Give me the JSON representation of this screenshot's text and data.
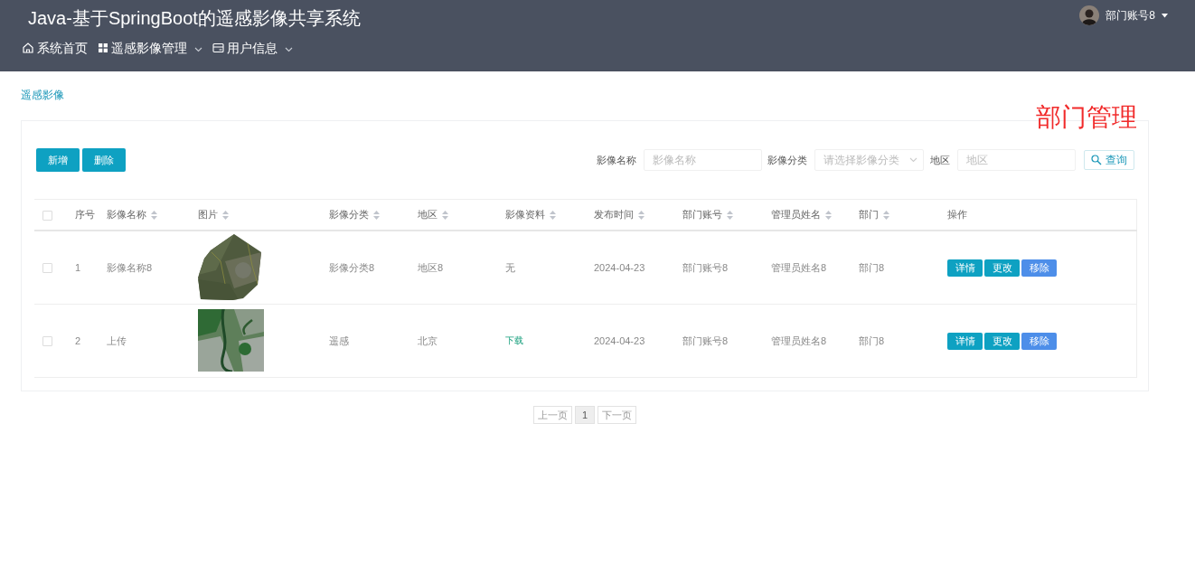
{
  "header": {
    "title": "Java-基于SpringBoot的遥感影像共享系统",
    "nav": [
      {
        "label": "系统首页",
        "dropdown": false
      },
      {
        "label": "遥感影像管理",
        "dropdown": true
      },
      {
        "label": "用户信息",
        "dropdown": true
      }
    ],
    "user": {
      "name": "部门账号8"
    }
  },
  "breadcrumb": "遥感影像",
  "overlay_caption": "部门管理",
  "toolbar": {
    "buttons": [
      "新增",
      "删除"
    ],
    "filters": [
      {
        "label": "影像名称",
        "kind": "input",
        "placeholder": "影像名称"
      },
      {
        "label": "影像分类",
        "kind": "select",
        "placeholder": "请选择影像分类"
      },
      {
        "label": "地区",
        "kind": "input",
        "placeholder": "地区"
      }
    ],
    "search_button": "查询"
  },
  "table": {
    "select_all_checked": false,
    "columns": [
      {
        "label": "序号",
        "sortable": false
      },
      {
        "label": "影像名称",
        "sortable": true
      },
      {
        "label": "图片",
        "sortable": true
      },
      {
        "label": "影像分类",
        "sortable": true
      },
      {
        "label": "地区",
        "sortable": true
      },
      {
        "label": "影像资料",
        "sortable": true
      },
      {
        "label": "发布时间",
        "sortable": true
      },
      {
        "label": "部门账号",
        "sortable": true
      },
      {
        "label": "管理员姓名",
        "sortable": true
      },
      {
        "label": "部门",
        "sortable": true
      },
      {
        "label": "操作",
        "sortable": false
      }
    ],
    "rows": [
      {
        "checked": false,
        "index": "1",
        "name": "影像名称8",
        "category": "影像分类8",
        "region": "地区8",
        "material": {
          "text": "无",
          "link": false
        },
        "published": "2024-04-23",
        "account": "部门账号8",
        "admin": "管理员姓名8",
        "department": "部门8",
        "actions": [
          {
            "label": "详情",
            "kind": "normal"
          },
          {
            "label": "更改",
            "kind": "normal"
          },
          {
            "label": "移除",
            "kind": "danger"
          }
        ]
      },
      {
        "checked": false,
        "index": "2",
        "name": "上传",
        "category": "遥感",
        "region": "北京",
        "material": {
          "text": "下载",
          "link": true
        },
        "published": "2024-04-23",
        "account": "部门账号8",
        "admin": "管理员姓名8",
        "department": "部门8",
        "actions": [
          {
            "label": "详情",
            "kind": "normal"
          },
          {
            "label": "更改",
            "kind": "normal"
          },
          {
            "label": "移除",
            "kind": "danger"
          }
        ]
      }
    ]
  },
  "pagination": {
    "prev": "上一页",
    "pages": [
      {
        "label": "1",
        "selected": true
      }
    ],
    "next": "下一页"
  }
}
